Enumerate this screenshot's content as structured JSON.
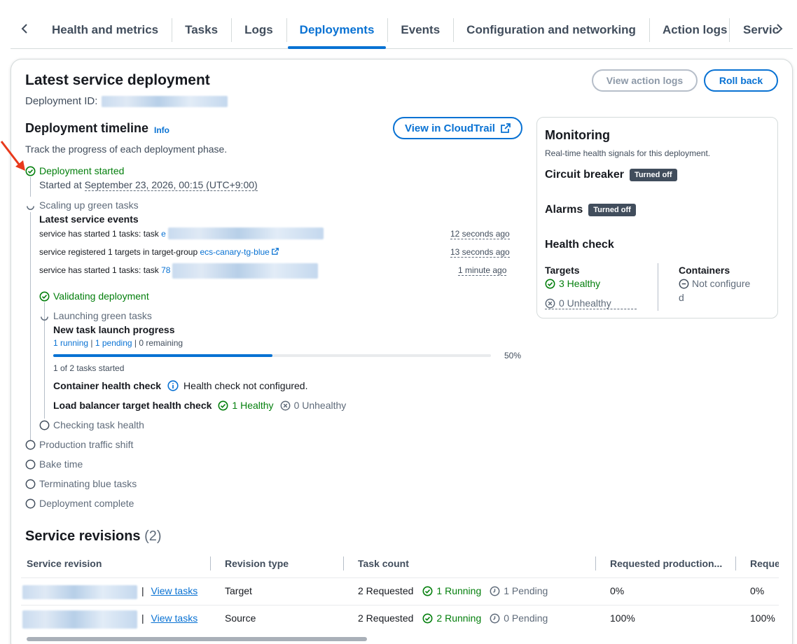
{
  "tabs": [
    "Health and metrics",
    "Tasks",
    "Logs",
    "Deployments",
    "Events",
    "Configuration and networking",
    "Action logs",
    "Service"
  ],
  "active_tab": "Deployments",
  "latest": {
    "title": "Latest service deployment",
    "deployment_id_label": "Deployment ID:",
    "view_action_logs": "View action logs",
    "roll_back": "Roll back"
  },
  "timeline": {
    "title": "Deployment timeline",
    "info": "Info",
    "view_cloudtrail": "View in CloudTrail",
    "description": "Track the progress of each deployment phase.",
    "started": {
      "label": "Deployment started",
      "started_at_prefix": "Started at",
      "started_at": "September 23, 2026, 00:15 (UTC+9:00)"
    },
    "scaling": {
      "label": "Scaling up green tasks",
      "events_title": "Latest service events",
      "events": [
        {
          "text": "service has started 1 tasks: task",
          "link": "e",
          "time": "12 seconds ago"
        },
        {
          "text": "service registered 1 targets in target-group",
          "link": "ecs-canary-tg-blue",
          "time": "13 seconds ago"
        },
        {
          "text": "service has started 1 tasks: task",
          "link": "78",
          "time": "1 minute ago"
        }
      ]
    },
    "validating": {
      "label": "Validating deployment",
      "launching": "Launching green tasks",
      "progress_title": "New task launch progress",
      "running": "1 running",
      "pending": "1 pending",
      "remaining": "0 remaining",
      "progress_percent": 50,
      "progress_label": "50%",
      "tasks_started": "1 of 2 tasks started",
      "container_hc_label": "Container health check",
      "container_hc_value": "Health check not configured.",
      "lb_hc_label": "Load balancer target health check",
      "lb_healthy": "1 Healthy",
      "lb_unhealthy": "0 Unhealthy",
      "checking": "Checking task health"
    },
    "pending_steps": [
      "Production traffic shift",
      "Bake time",
      "Terminating blue tasks",
      "Deployment complete"
    ]
  },
  "monitoring": {
    "title": "Monitoring",
    "subtitle": "Real-time health signals for this deployment.",
    "circuit_breaker": "Circuit breaker",
    "circuit_breaker_status": "Turned off",
    "alarms": "Alarms",
    "alarms_status": "Turned off",
    "health_check": "Health check",
    "targets_label": "Targets",
    "targets_healthy": "3 Healthy",
    "targets_unhealthy": "0 Unhealthy",
    "containers_label": "Containers",
    "containers_value_1": "Not configure",
    "containers_value_2": "d"
  },
  "revisions": {
    "title": "Service revisions",
    "count": "(2)",
    "columns": [
      "Service revision",
      "Revision type",
      "Task count",
      "Requested production...",
      "Reque"
    ],
    "rows": [
      {
        "view_tasks": "View tasks",
        "type": "Target",
        "requested": "2 Requested",
        "running": "1 Running",
        "pending": "1 Pending",
        "prod": "0%",
        "extra": "0%"
      },
      {
        "view_tasks": "View tasks",
        "type": "Source",
        "requested": "2 Requested",
        "running": "2 Running",
        "pending": "0 Pending",
        "prod": "100%",
        "extra": "100%"
      }
    ]
  },
  "colors": {
    "accent": "#0972d3",
    "success": "#037f0c",
    "text": "#16191f",
    "muted": "#5f6b7a",
    "annotation_arrow": "#e8391b"
  }
}
